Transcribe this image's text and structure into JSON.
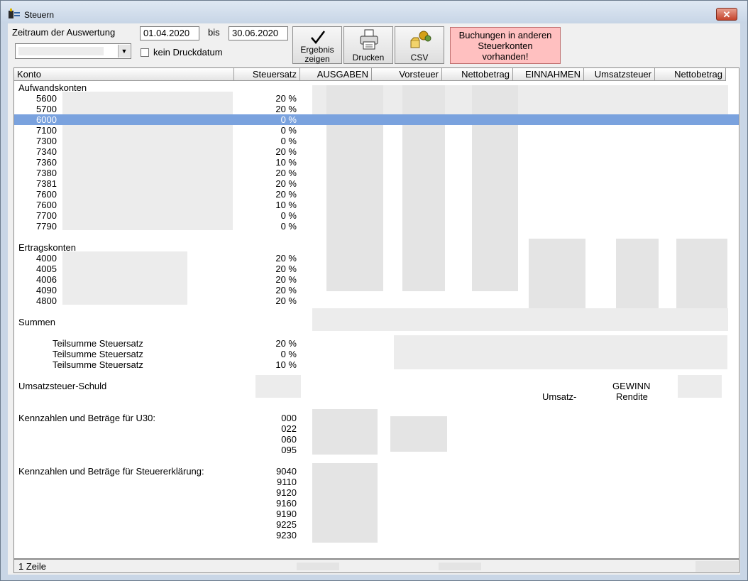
{
  "window": {
    "title": "Steuern",
    "close_glyph": "✕"
  },
  "filter": {
    "period_label": "Zeitraum der Auswertung",
    "from_date": "01.04.2020",
    "to_label": "bis",
    "to_date": "30.06.2020",
    "combo_value": "",
    "no_print_date_label": "kein Druckdatum",
    "no_print_date_checked": false
  },
  "toolbar": {
    "show_result_line1": "Ergebnis",
    "show_result_line2": "zeigen",
    "print_label": "Drucken",
    "csv_label": "CSV",
    "notice_line1": "Buchungen in anderen",
    "notice_line2": "Steuerkonten",
    "notice_line3": "vorhanden!"
  },
  "columns": [
    "Konto",
    "Steuersatz",
    "AUSGABEN",
    "Vorsteuer",
    "Nettobetrag",
    "EINNAHMEN",
    "Umsatzsteuer",
    "Nettobetrag"
  ],
  "sections": {
    "expenses_title": "Aufwandskonten",
    "income_title": "Ertragskonten",
    "sums_title": "Summen",
    "vat_debt_title": "Umsatzsteuer-Schuld",
    "u30_title": "Kennzahlen und Beträge für U30:",
    "tax_return_title": "Kennzahlen und Beträge für Steuererklärung:"
  },
  "expense_rows": [
    {
      "account": "5600",
      "rate": "20 %"
    },
    {
      "account": "5700",
      "rate": "20 %"
    },
    {
      "account": "6000",
      "rate": "0 %"
    },
    {
      "account": "7100",
      "rate": "0 %"
    },
    {
      "account": "7300",
      "rate": "0 %"
    },
    {
      "account": "7340",
      "rate": "20 %"
    },
    {
      "account": "7360",
      "rate": "10 %"
    },
    {
      "account": "7380",
      "rate": "20 %"
    },
    {
      "account": "7381",
      "rate": "20 %"
    },
    {
      "account": "7600",
      "rate": "20 %"
    },
    {
      "account": "7600",
      "rate": "10 %"
    },
    {
      "account": "7700",
      "rate": "0 %"
    },
    {
      "account": "7790",
      "rate": "0 %"
    }
  ],
  "income_rows": [
    {
      "account": "4000",
      "rate": "20 %"
    },
    {
      "account": "4005",
      "rate": "20 %"
    },
    {
      "account": "4006",
      "rate": "20 %"
    },
    {
      "account": "4090",
      "rate": "20 %"
    },
    {
      "account": "4800",
      "rate": "20 %"
    }
  ],
  "subtotals": [
    {
      "label": "Teilsumme Steuersatz",
      "rate": "20 %"
    },
    {
      "label": "Teilsumme Steuersatz",
      "rate": "0 %"
    },
    {
      "label": "Teilsumme Steuersatz",
      "rate": "10 %"
    }
  ],
  "profit": {
    "gewinn": "GEWINN",
    "umsatz": "Umsatz-",
    "rendite": "Rendite"
  },
  "u30_codes": [
    "000",
    "022",
    "060",
    "095"
  ],
  "tax_codes": [
    "9040",
    "9110",
    "9120",
    "9160",
    "9190",
    "9225",
    "9230"
  ],
  "status": {
    "rows": "1 Zeile"
  }
}
